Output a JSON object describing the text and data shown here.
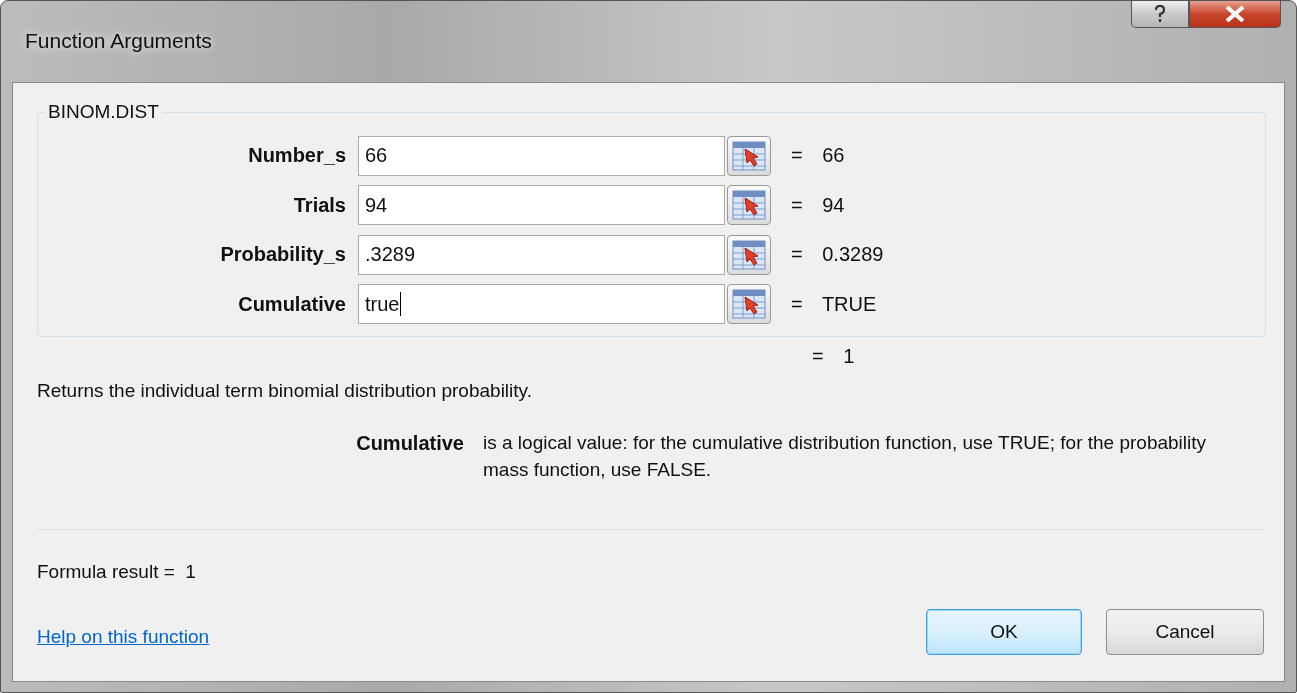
{
  "window": {
    "title": "Function Arguments"
  },
  "function_group": {
    "name": "BINOM.DIST",
    "arguments": [
      {
        "label": "Number_s",
        "value": "66",
        "result": "= 66",
        "focused": false
      },
      {
        "label": "Trials",
        "value": "94",
        "result": "= 94",
        "focused": false
      },
      {
        "label": "Probability_s",
        "value": ".3289",
        "result": "= 0.3289",
        "focused": false
      },
      {
        "label": "Cumulative",
        "value": "true",
        "result": "= TRUE",
        "focused": true
      }
    ]
  },
  "overall_result": "= 1",
  "description": "Returns the individual term binomial distribution probability.",
  "argument_help": {
    "label": "Cumulative",
    "text": "is a logical value: for the cumulative distribution function, use TRUE; for the probability mass function, use FALSE."
  },
  "formula_result": "Formula result =  1",
  "help_link": "Help on this function",
  "buttons": [
    {
      "label": "OK",
      "default": true
    },
    {
      "label": "Cancel",
      "default": false
    }
  ]
}
